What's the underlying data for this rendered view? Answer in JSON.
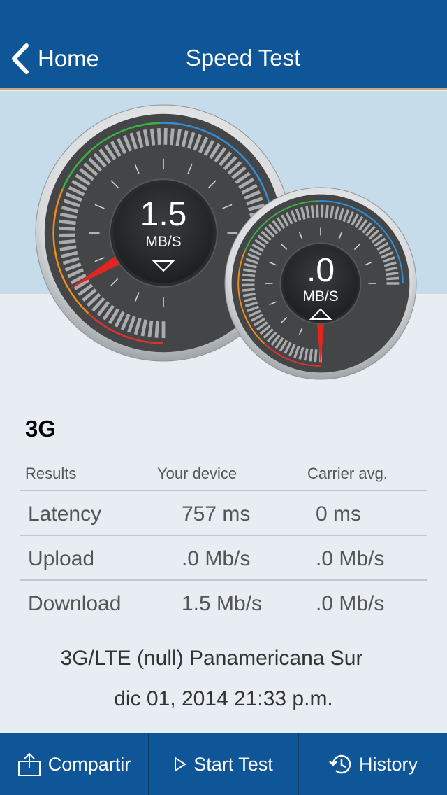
{
  "nav": {
    "back_label": "Home",
    "title": "Speed Test"
  },
  "gauges": {
    "download": {
      "value": "1.5",
      "unit": "MB/S",
      "needle_fraction": 0.22,
      "direction_icon": "triangle-down-icon"
    },
    "upload": {
      "value": ".0",
      "unit": "MB/S",
      "needle_fraction": 0.0,
      "direction_icon": "triangle-up-icon"
    }
  },
  "network_type": "3G",
  "results": {
    "headers": [
      "Results",
      "Your device",
      "Carrier avg."
    ],
    "rows": [
      {
        "label": "Latency",
        "device": "757 ms",
        "carrier": "0 ms"
      },
      {
        "label": "Upload",
        "device": ".0 Mb/s",
        "carrier": ".0 Mb/s"
      },
      {
        "label": "Download",
        "device": "1.5 Mb/s",
        "carrier": ".0 Mb/s"
      }
    ]
  },
  "connection_info": "3G/LTE (null) Panamericana Sur",
  "timestamp": "dic 01, 2014 21:33 p.m.",
  "tabbar": {
    "share_label": "Compartir",
    "start_label": "Start Test",
    "history_label": "History"
  },
  "colors": {
    "brand_blue": "#0f5699",
    "gauge_face": "#434547",
    "needle": "#e0261f"
  }
}
